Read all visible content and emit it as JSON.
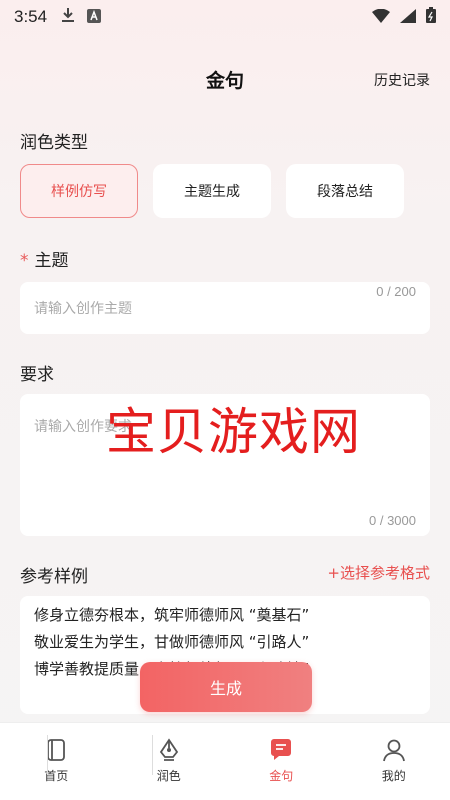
{
  "status_bar": {
    "time": "3:54"
  },
  "header": {
    "title": "金句",
    "history_label": "历史记录"
  },
  "polish_type": {
    "label": "润色类型",
    "options": [
      {
        "label": "样例仿写",
        "active": true
      },
      {
        "label": "主题生成",
        "active": false
      },
      {
        "label": "段落总结",
        "active": false
      }
    ]
  },
  "topic": {
    "required_mark": "*",
    "label": "主题",
    "placeholder": "请输入创作主题",
    "counter": "0 / 200"
  },
  "requirement": {
    "label": "要求",
    "placeholder": "请输入创作要求",
    "counter": "0 / 3000"
  },
  "reference": {
    "label": "参考样例",
    "select_label": "+选择参考格式",
    "lines": [
      "修身立德夯根本，筑牢师德师风 “奠基石”",
      "敬业爱生为学生，甘做师德师风 “引路人”",
      "博学善教提质量，守护师德师风 “主阵地”"
    ]
  },
  "watermark": "宝贝游戏网",
  "generate_label": "生成",
  "tabs": [
    {
      "label": "首页",
      "icon": "book-icon",
      "active": false
    },
    {
      "label": "润色",
      "icon": "pen-nib-icon",
      "active": false
    },
    {
      "label": "金句",
      "icon": "chat-bubble-icon",
      "active": true
    },
    {
      "label": "我的",
      "icon": "user-icon",
      "active": false
    }
  ],
  "colors": {
    "accent": "#e8504f",
    "background": "#f5f4f4"
  }
}
